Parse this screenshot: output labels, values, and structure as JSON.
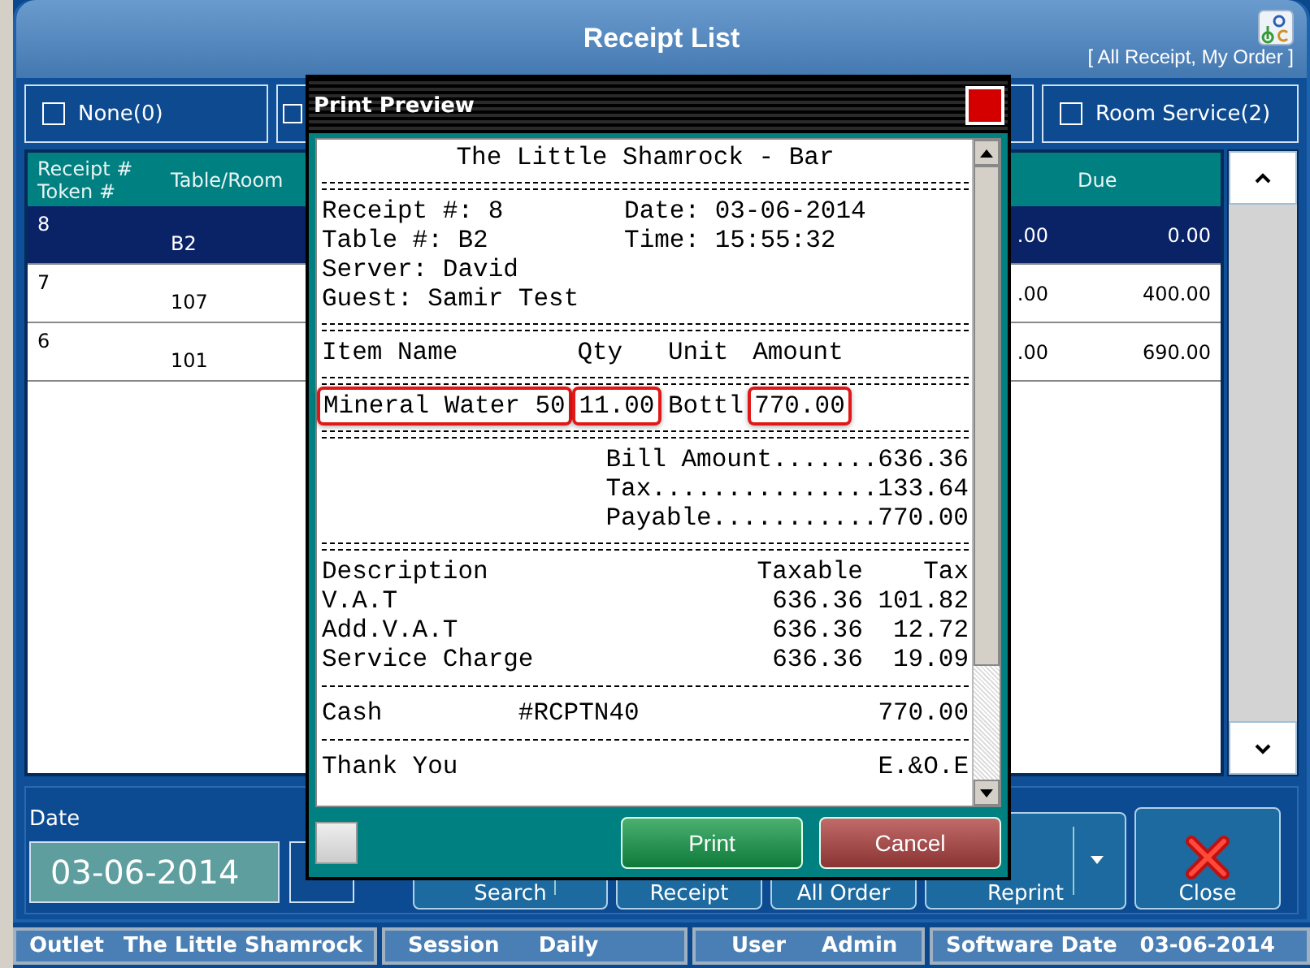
{
  "window": {
    "title": "Receipt List",
    "subtitle": "[ All Receipt, My Order ]"
  },
  "filter_tabs": [
    {
      "label": "None(0)",
      "checked": false
    },
    {
      "checked": false
    },
    {
      "label": "Room Service(2)",
      "checked": false
    }
  ],
  "table": {
    "header": {
      "receipt": "Receipt #",
      "token": "Token #",
      "table_room": "Table/Room",
      "due": "Due"
    },
    "rows": [
      {
        "receipt": "8",
        "table_room": "B2",
        "column_3": ".00",
        "due": "0.00",
        "selected": true
      },
      {
        "receipt": "7",
        "table_room": "107",
        "column_3": ".00",
        "due": "400.00",
        "selected": false
      },
      {
        "receipt": "6",
        "table_room": "101",
        "column_3": ".00",
        "due": "690.00",
        "selected": false
      }
    ]
  },
  "date": {
    "label": "Date",
    "value": "03-06-2014"
  },
  "actions": [
    {
      "label": "Search",
      "kind": "split"
    },
    {
      "label": "Receipt",
      "kind": "plain"
    },
    {
      "label": "All Order",
      "kind": "plain"
    },
    {
      "label": "Reprint",
      "kind": "dropdown"
    },
    {
      "label": "Close",
      "kind": "close"
    }
  ],
  "status_bar": [
    {
      "label": "Outlet",
      "value": "The Little Shamrock"
    },
    {
      "label": "Session",
      "value": "Daily"
    },
    {
      "label": "User",
      "value": "Admin"
    },
    {
      "label": "Software Date",
      "value": "03-06-2014"
    }
  ],
  "dialog": {
    "title": "Print Preview",
    "lines": [
      {
        "kind": "title",
        "text": "The Little Shamrock - Bar"
      },
      {
        "kind": "double_rule"
      },
      {
        "kind": "info",
        "cells": [
          {
            "text": "Receipt #: 8"
          },
          {
            "text": "Date: 03-06-2014"
          }
        ]
      },
      {
        "kind": "info",
        "cells": [
          {
            "text": "Table #: B2"
          },
          {
            "text": "Time: 15:55:32"
          }
        ]
      },
      {
        "kind": "info",
        "cells": [
          {
            "text": "Server: David"
          }
        ]
      },
      {
        "kind": "info",
        "cells": [
          {
            "text": "Guest: Samir Test"
          }
        ]
      },
      {
        "kind": "double_rule"
      },
      {
        "kind": "item",
        "cells": [
          {
            "text": "Item Name",
            "highlighted": false
          },
          {
            "text": "Qty",
            "highlighted": false
          },
          {
            "text": "Unit",
            "highlighted": false
          },
          {
            "text": "Amount",
            "highlighted": false
          }
        ]
      },
      {
        "kind": "double_rule"
      },
      {
        "kind": "item",
        "cells": [
          {
            "text": "Mineral Water 50",
            "highlighted": true
          },
          {
            "text": "11.00",
            "highlighted": true
          },
          {
            "text": "Bottl",
            "highlighted": false
          },
          {
            "text": "770.00",
            "highlighted": true
          }
        ]
      },
      {
        "kind": "double_rule"
      },
      {
        "kind": "total",
        "text": "Bill Amount.......636.36"
      },
      {
        "kind": "total",
        "text": "Tax...............133.64"
      },
      {
        "kind": "total",
        "text": "Payable...........770.00"
      },
      {
        "kind": "double_rule"
      },
      {
        "kind": "tax",
        "cells": [
          {
            "text": "Description"
          },
          {
            "text": "Taxable"
          },
          {
            "text": "Tax"
          }
        ]
      },
      {
        "kind": "tax",
        "cells": [
          {
            "text": "V.A.T"
          },
          {
            "text": "636.36"
          },
          {
            "text": "101.82"
          }
        ]
      },
      {
        "kind": "tax",
        "cells": [
          {
            "text": "Add.V.A.T"
          },
          {
            "text": "636.36"
          },
          {
            "text": "12.72"
          }
        ]
      },
      {
        "kind": "tax",
        "cells": [
          {
            "text": "Service Charge"
          },
          {
            "text": "636.36"
          },
          {
            "text": "19.09"
          }
        ]
      },
      {
        "kind": "single_rule"
      },
      {
        "kind": "cash",
        "cells": [
          {
            "text": "Cash"
          },
          {
            "text": "#RCPTN40"
          },
          {
            "text": "770.00"
          }
        ]
      },
      {
        "kind": "single_rule"
      },
      {
        "kind": "split",
        "cells": [
          {
            "text": "Thank You"
          },
          {
            "text": "E.&O.E"
          }
        ]
      }
    ],
    "buttons": [
      {
        "label": "Print",
        "kind": "primary"
      },
      {
        "label": "Cancel",
        "kind": "secondary"
      }
    ]
  }
}
